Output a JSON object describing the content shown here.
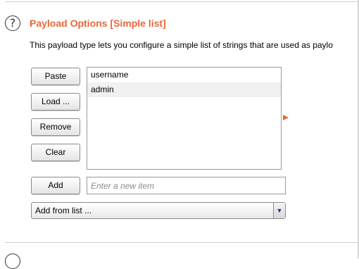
{
  "section": {
    "help_symbol": "?",
    "title": "Payload Options [Simple list]",
    "description": "This payload type lets you configure a simple list of strings that are used as paylo"
  },
  "buttons": {
    "paste": "Paste",
    "load": "Load ...",
    "remove": "Remove",
    "clear": "Clear",
    "add": "Add"
  },
  "list": {
    "items": [
      "username",
      "admin"
    ]
  },
  "add_field": {
    "placeholder": "Enter a new item",
    "value": ""
  },
  "add_from_list": {
    "selected": "Add from list ...",
    "arrow_symbol": "▼"
  },
  "colors": {
    "accent": "#e8683a"
  }
}
